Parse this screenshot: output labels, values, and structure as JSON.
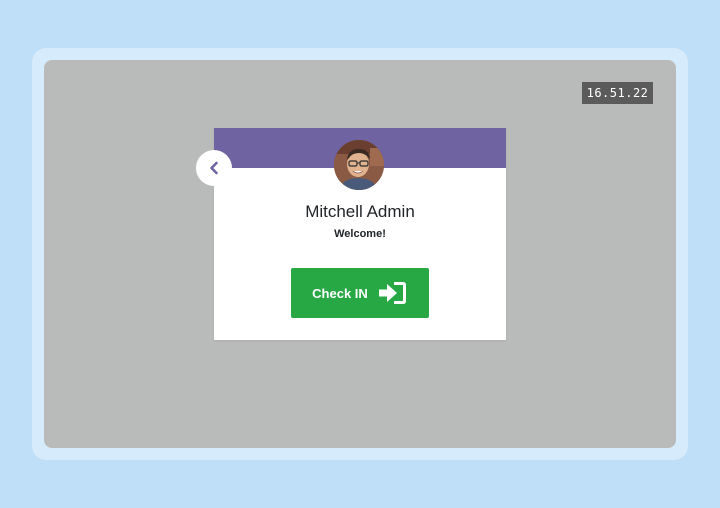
{
  "clock": {
    "time": "16.51.22"
  },
  "card": {
    "employee_name": "Mitchell Admin",
    "greeting": "Welcome!",
    "check_in_label": "Check IN",
    "header_color": "#6f63a1",
    "button_color": "#28a745"
  },
  "icons": {
    "back": "chevron-left-icon",
    "check_in": "sign-in-icon",
    "avatar": "user-photo"
  }
}
